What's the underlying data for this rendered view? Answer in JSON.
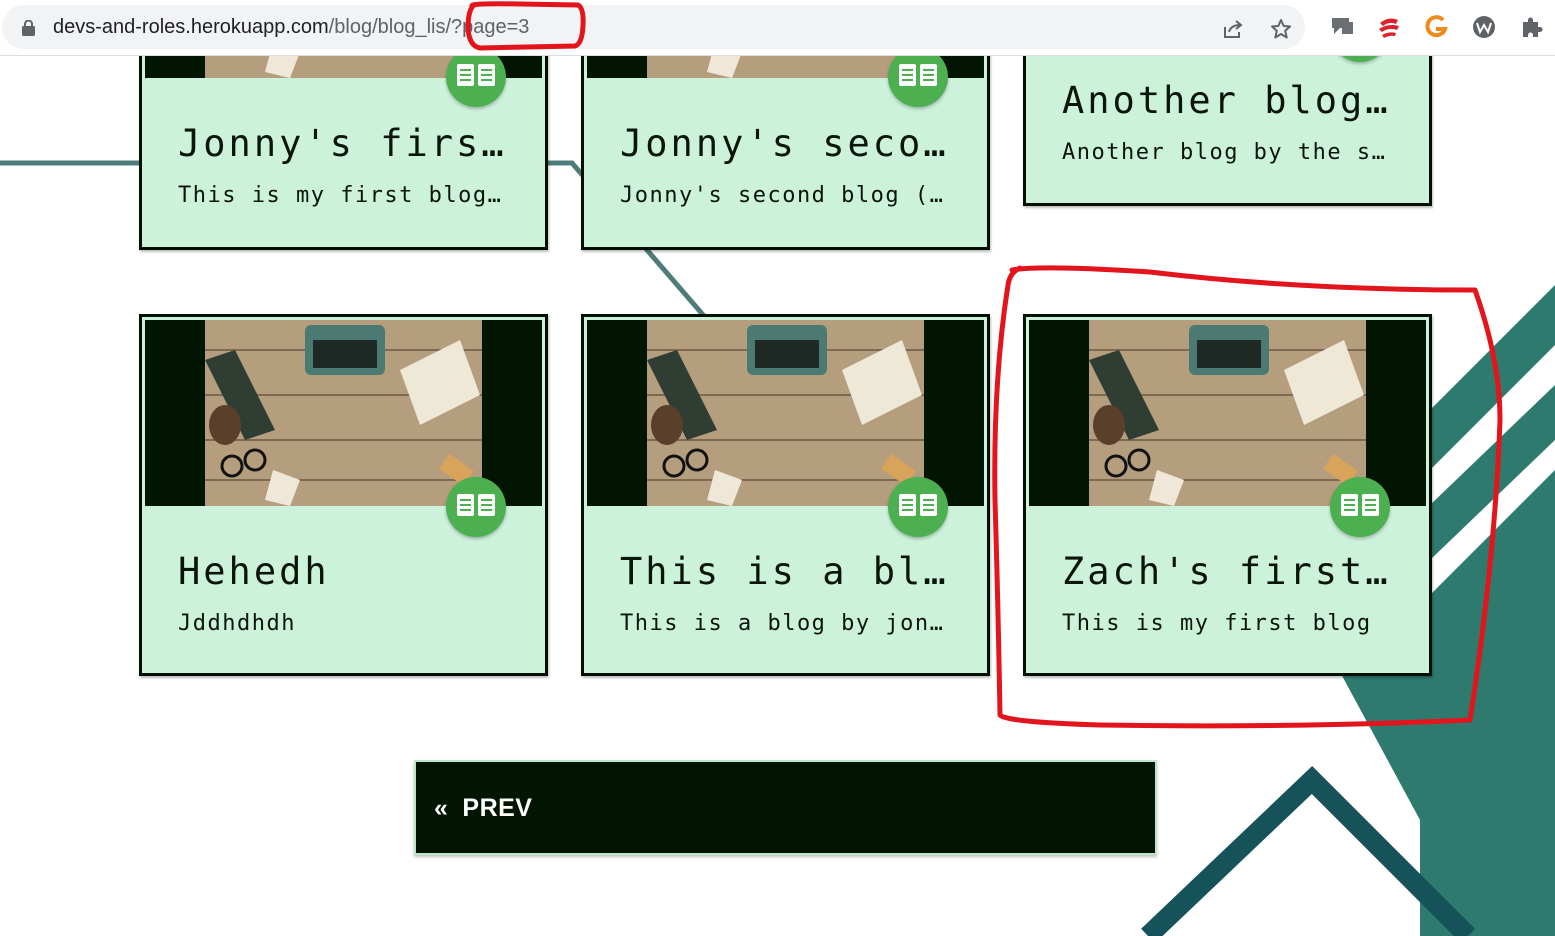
{
  "browser": {
    "url_host": "devs-and-roles.herokuapp.com",
    "url_path": "/blog/blog_lis",
    "url_query": "/?page=3"
  },
  "cards": [
    {
      "title": "Jonny's first blog",
      "excerpt": "This is my first blog: Jonny"
    },
    {
      "title": "Jonny's second blog",
      "excerpt": "Jonny's second blog (edited)"
    },
    {
      "title": "Another blog by the site",
      "excerpt": "Another blog by the site owner"
    },
    {
      "title": "Hehedh",
      "excerpt": "Jddhdhdh"
    },
    {
      "title": "This is a blog by jonny",
      "excerpt": "This is a blog by jonny"
    },
    {
      "title": "Zach's first blog",
      "excerpt": "This is my first blog"
    }
  ],
  "pagination": {
    "prev_arrow": "«",
    "prev_label": "PREV"
  },
  "colors": {
    "card_bg": "#cdf2dc",
    "badge": "#4caf50",
    "dark": "#021402",
    "teal": "#2f7d72",
    "annotation": "#e3141b"
  }
}
